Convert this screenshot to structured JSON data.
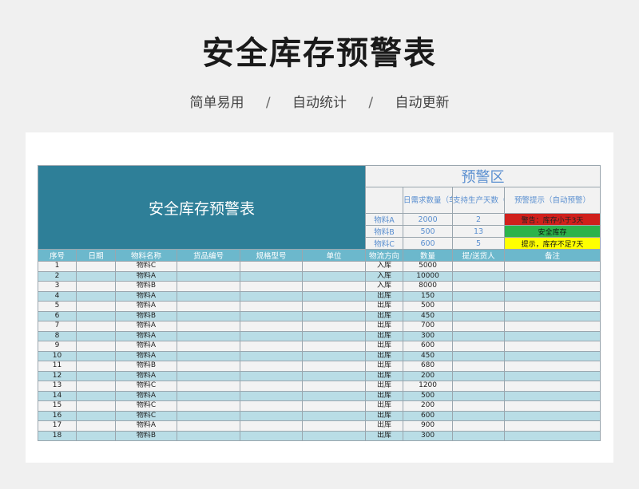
{
  "header": {
    "title": "安全库存预警表",
    "tags": [
      "简单易用",
      "自动统计",
      "自动更新"
    ],
    "separator": "/"
  },
  "sheet": {
    "banner_title": "安全库存预警表",
    "warning": {
      "title": "预警区",
      "col_daily": "日需求数量（车间提供）",
      "col_days": "支持生产天数（自动生成）",
      "col_tip": "预警提示（自动预警）",
      "rows": [
        {
          "name": "物料A",
          "daily": "2000",
          "days": "2",
          "tip": "警告：库存小于3天",
          "color": "#d0201c",
          "cls": "red"
        },
        {
          "name": "物料B",
          "daily": "500",
          "days": "13",
          "tip": "安全库存",
          "color": "#2cb34a",
          "cls": "green"
        },
        {
          "name": "物料C",
          "daily": "600",
          "days": "5",
          "tip": "提示，库存不足7天",
          "color": "#ffff00",
          "cls": "yellow"
        }
      ]
    },
    "columns": [
      "序号",
      "日期",
      "物料名称",
      "货品编号",
      "规格型号",
      "单位",
      "物流方向",
      "数量",
      "提/送货人",
      "备注"
    ],
    "rows": [
      {
        "no": "1",
        "date": "",
        "item": "物料C",
        "code": "",
        "spec": "",
        "unit": "",
        "dir": "入库",
        "qty": "5000",
        "person": "",
        "note": ""
      },
      {
        "no": "2",
        "date": "",
        "item": "物料A",
        "code": "",
        "spec": "",
        "unit": "",
        "dir": "入库",
        "qty": "10000",
        "person": "",
        "note": ""
      },
      {
        "no": "3",
        "date": "",
        "item": "物料B",
        "code": "",
        "spec": "",
        "unit": "",
        "dir": "入库",
        "qty": "8000",
        "person": "",
        "note": ""
      },
      {
        "no": "4",
        "date": "",
        "item": "物料A",
        "code": "",
        "spec": "",
        "unit": "",
        "dir": "出库",
        "qty": "150",
        "person": "",
        "note": ""
      },
      {
        "no": "5",
        "date": "",
        "item": "物料A",
        "code": "",
        "spec": "",
        "unit": "",
        "dir": "出库",
        "qty": "500",
        "person": "",
        "note": ""
      },
      {
        "no": "6",
        "date": "",
        "item": "物料B",
        "code": "",
        "spec": "",
        "unit": "",
        "dir": "出库",
        "qty": "450",
        "person": "",
        "note": ""
      },
      {
        "no": "7",
        "date": "",
        "item": "物料A",
        "code": "",
        "spec": "",
        "unit": "",
        "dir": "出库",
        "qty": "700",
        "person": "",
        "note": ""
      },
      {
        "no": "8",
        "date": "",
        "item": "物料A",
        "code": "",
        "spec": "",
        "unit": "",
        "dir": "出库",
        "qty": "300",
        "person": "",
        "note": ""
      },
      {
        "no": "9",
        "date": "",
        "item": "物料A",
        "code": "",
        "spec": "",
        "unit": "",
        "dir": "出库",
        "qty": "600",
        "person": "",
        "note": ""
      },
      {
        "no": "10",
        "date": "",
        "item": "物料A",
        "code": "",
        "spec": "",
        "unit": "",
        "dir": "出库",
        "qty": "450",
        "person": "",
        "note": ""
      },
      {
        "no": "11",
        "date": "",
        "item": "物料B",
        "code": "",
        "spec": "",
        "unit": "",
        "dir": "出库",
        "qty": "680",
        "person": "",
        "note": ""
      },
      {
        "no": "12",
        "date": "",
        "item": "物料A",
        "code": "",
        "spec": "",
        "unit": "",
        "dir": "出库",
        "qty": "200",
        "person": "",
        "note": ""
      },
      {
        "no": "13",
        "date": "",
        "item": "物料C",
        "code": "",
        "spec": "",
        "unit": "",
        "dir": "出库",
        "qty": "1200",
        "person": "",
        "note": ""
      },
      {
        "no": "14",
        "date": "",
        "item": "物料A",
        "code": "",
        "spec": "",
        "unit": "",
        "dir": "出库",
        "qty": "500",
        "person": "",
        "note": ""
      },
      {
        "no": "15",
        "date": "",
        "item": "物料C",
        "code": "",
        "spec": "",
        "unit": "",
        "dir": "出库",
        "qty": "200",
        "person": "",
        "note": ""
      },
      {
        "no": "16",
        "date": "",
        "item": "物料C",
        "code": "",
        "spec": "",
        "unit": "",
        "dir": "出库",
        "qty": "600",
        "person": "",
        "note": ""
      },
      {
        "no": "17",
        "date": "",
        "item": "物料A",
        "code": "",
        "spec": "",
        "unit": "",
        "dir": "出库",
        "qty": "900",
        "person": "",
        "note": ""
      },
      {
        "no": "18",
        "date": "",
        "item": "物料B",
        "code": "",
        "spec": "",
        "unit": "",
        "dir": "出库",
        "qty": "300",
        "person": "",
        "note": ""
      }
    ]
  }
}
